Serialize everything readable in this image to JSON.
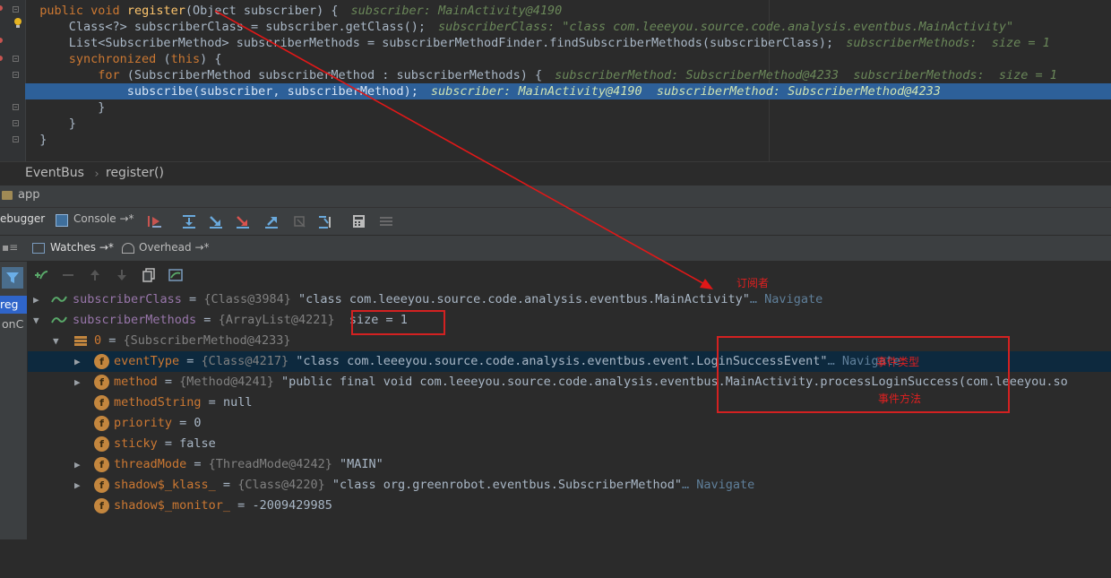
{
  "editor": {
    "lines": [
      {
        "code": "public void register(Object subscriber) {",
        "hint": "subscriber: MainActivity@4190"
      },
      {
        "code": "    Class<?> subscriberClass = subscriber.getClass();",
        "hint": "subscriberClass: \"class com.leeeyou.source.code.analysis.eventbus.MainActivity\""
      },
      {
        "code": "    List<SubscriberMethod> subscriberMethods = subscriberMethodFinder.findSubscriberMethods(subscriberClass);",
        "hint": "subscriberMethods:  size = 1"
      },
      {
        "code": "    synchronized (this) {",
        "hint": ""
      },
      {
        "code": "        for (SubscriberMethod subscriberMethod : subscriberMethods) {",
        "hint": "subscriberMethod: SubscriberMethod@4233  subscriberMethods:  size = 1"
      },
      {
        "code": "            subscribe(subscriber, subscriberMethod);",
        "hint": "subscriber: MainActivity@4190  subscriberMethod: SubscriberMethod@4233"
      },
      {
        "code": "        }",
        "hint": ""
      },
      {
        "code": "    }",
        "hint": ""
      },
      {
        "code": "}",
        "hint": ""
      }
    ]
  },
  "breadcrumb": {
    "class_name": "EventBus",
    "separator": "›",
    "method": "register()"
  },
  "debug_panel": {
    "title": "app",
    "tabs": {
      "debugger": "ebugger",
      "console": "Console",
      "console_suffix": "→*"
    },
    "subtabs": {
      "watches": "Watches",
      "watches_suffix": "→*",
      "overhead": "Overhead",
      "overhead_suffix": "→*"
    },
    "frames": {
      "selected": "reg",
      "second": "onC"
    }
  },
  "variables": [
    {
      "name": "subscriberClass",
      "value_ref": "{Class@3984}",
      "value": "\"class com.leeeyou.source.code.analysis.eventbus.MainActivity\"",
      "nav": "… Navigate"
    },
    {
      "name": "subscriberMethods",
      "value_ref": "{ArrayList@4221}",
      "value": " size = 1",
      "nav": ""
    },
    {
      "name": "0",
      "value_ref": "{SubscriberMethod@4233}",
      "value": "",
      "nav": ""
    },
    {
      "name": "eventType",
      "value_ref": "{Class@4217}",
      "value": "\"class com.leeeyou.source.code.analysis.eventbus.event.LoginSuccessEvent\"",
      "nav": "… Navigate"
    },
    {
      "name": "method",
      "value_ref": "{Method@4241}",
      "value": "\"public final void com.leeeyou.source.code.analysis.eventbus.MainActivity.processLoginSuccess(com.leeeyou.so",
      "nav": ""
    },
    {
      "name": "methodString",
      "value_ref": "",
      "value": "null",
      "nav": ""
    },
    {
      "name": "priority",
      "value_ref": "",
      "value": "0",
      "nav": ""
    },
    {
      "name": "sticky",
      "value_ref": "",
      "value": "false",
      "nav": ""
    },
    {
      "name": "threadMode",
      "value_ref": "{ThreadMode@4242}",
      "value": "\"MAIN\"",
      "nav": ""
    },
    {
      "name": "shadow$_klass_",
      "value_ref": "{Class@4220}",
      "value": "\"class org.greenrobot.eventbus.SubscriberMethod\"",
      "nav": "… Navigate"
    },
    {
      "name": "shadow$_monitor_",
      "value_ref": "",
      "value": "-2009429985",
      "nav": ""
    }
  ],
  "annotations": {
    "subscriber_label": "订阅者",
    "event_label": "事件类型",
    "method_label": "事件方法"
  },
  "colors": {
    "background": "#2b2b2b",
    "current_line": "#2d6099",
    "annotation_red": "#d32121",
    "keyword": "#cc7832",
    "hint": "#6a8759"
  }
}
